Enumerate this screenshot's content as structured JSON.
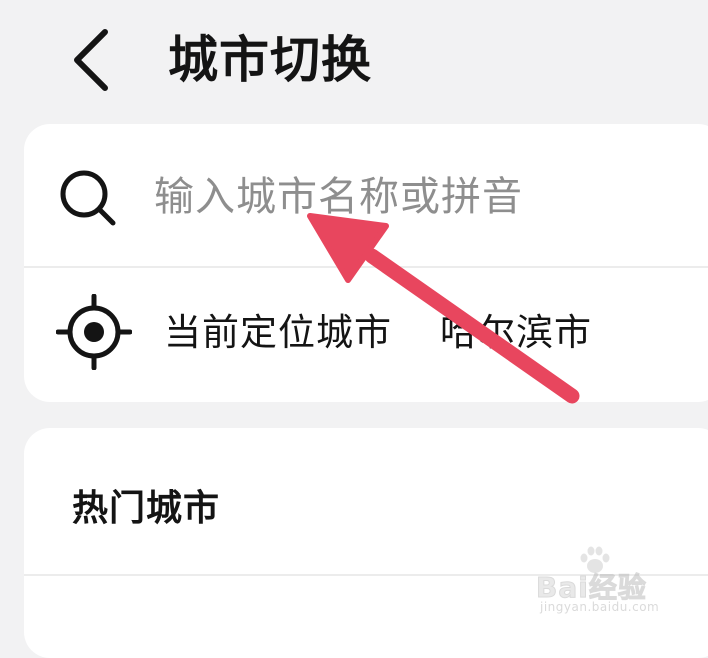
{
  "header": {
    "back_icon": "chevron-left-icon",
    "title": "城市切换"
  },
  "search": {
    "icon": "search-icon",
    "placeholder": "输入城市名称或拼音",
    "value": ""
  },
  "location": {
    "icon": "locate-icon",
    "label": "当前定位城市",
    "city": "哈尔滨市"
  },
  "hot_cities": {
    "title": "热门城市"
  },
  "annotation": {
    "arrow_color": "#e8465e"
  },
  "watermark": {
    "brand": "Bai经验",
    "url": "jingyan.baidu.com"
  }
}
